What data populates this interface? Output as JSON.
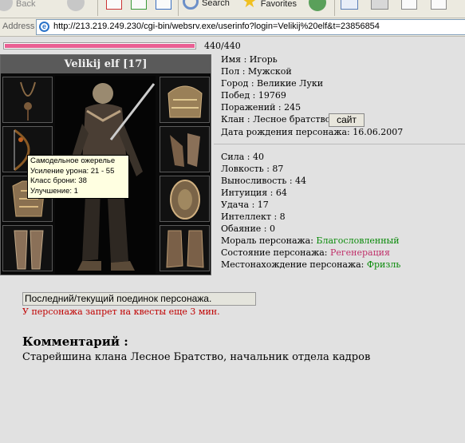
{
  "toolbar": {
    "back_label": "Back",
    "search_label": "Search",
    "favorites_label": "Favorites"
  },
  "address": {
    "label": "Address",
    "url": "http://213.219.249.230/cgi-bin/websrv.exe/userinfo?login=Velikij%20elf&t=23856854"
  },
  "hp": {
    "text": "440/440",
    "current": 440,
    "max": 440
  },
  "character": {
    "name": "Velikij elf [17]",
    "tooltip": {
      "title": "Самодельное ожерелье",
      "damage": "Усиление урона: 21 - 55",
      "armor": "Класс брони: 38",
      "upgrade": "Улучшение: 1"
    }
  },
  "profile": {
    "name": "Имя : Игорь",
    "gender": "Пол : Мужской",
    "city": "Город : Великие Луки",
    "wins": "Побед : 19769",
    "losses": "Поражений : 245",
    "clan": "Клан : Лесное братство:",
    "site_button": "сайт",
    "birth": "Дата рождения персонажа: 16.06.2007"
  },
  "stats": {
    "strength": "Сила : 40",
    "agility": "Ловкость : 87",
    "endurance": "Выносливость : 44",
    "intuition": "Интуиция : 64",
    "luck": "Удача : 17",
    "intellect": "Интеллект : 8",
    "charm": "Обаяние : 0",
    "morale_label": "Мораль персонажа: ",
    "morale_value": "Благословленный",
    "state_label": "Состояние персонажа: ",
    "state_value": "Регенерация",
    "location_label": "Местонахождение персонажа: ",
    "location_value": "Фризль"
  },
  "battle_button": "Последний/текущий поединок персонажа.",
  "quest_ban": "У персонажа запрет на квесты еще 3 мин.",
  "comment": {
    "title": "Комментарий :",
    "text": "Старейшина клана Лесное Братство, начальник отдела кадров"
  },
  "colors": {
    "hp_fill": "#e95f93",
    "green_text": "#0a8a0a",
    "pink_text": "#c0306a",
    "red_text": "#c00000"
  }
}
